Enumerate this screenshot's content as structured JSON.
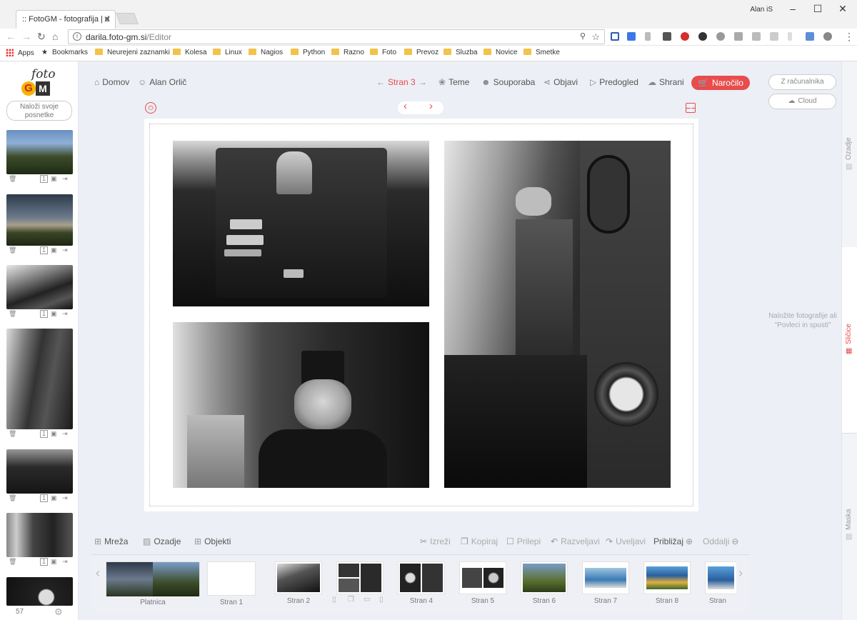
{
  "browser": {
    "tab_title": ":: FotoGM - fotografija | d",
    "user": "Alan iS",
    "url_host": "darila.foto-gm.si",
    "url_path": "/Editor",
    "bookmarks": [
      "Apps",
      "Bookmarks",
      "Neurejeni zaznamki",
      "Kolesa",
      "Linux",
      "Nagios",
      "Python",
      "Razno",
      "Foto",
      "Prevoz",
      "Sluzba",
      "Novice",
      "Smetke"
    ]
  },
  "sidebar": {
    "upload_label": "Naloži svoje posnetke",
    "photo_count": "57",
    "thumb_badge": "1"
  },
  "toolbar": {
    "home": "Domov",
    "user": "Alan Orlič",
    "page": "Stran 3",
    "themes": "Teme",
    "collab": "Souporaba",
    "publish": "Objavi",
    "preview": "Predogled",
    "save": "Shrani",
    "order": "Naročilo"
  },
  "bottom_toolbar": {
    "grid": "Mreža",
    "backgrounds": "Ozadje",
    "objects": "Objekti",
    "cut": "Izreži",
    "copy": "Kopiraj",
    "paste": "Prilepi",
    "undo": "Razveljavi",
    "redo": "Uveljavi",
    "zoom_in": "Približaj",
    "zoom_out": "Oddalji"
  },
  "pages_strip": [
    "Platnica",
    "Stran 1",
    "Stran 2",
    "Stran 4",
    "Stran 5",
    "Stran 6",
    "Stran 7",
    "Stran 8",
    "Stran"
  ],
  "right_panel": {
    "from_computer": "Z računalnika",
    "cloud": "Cloud",
    "drop_hint": "Naložite fotografije ali \"Povleci in spusti\"",
    "tabs": [
      "Ozadje",
      "Sličice",
      "Maska"
    ]
  }
}
